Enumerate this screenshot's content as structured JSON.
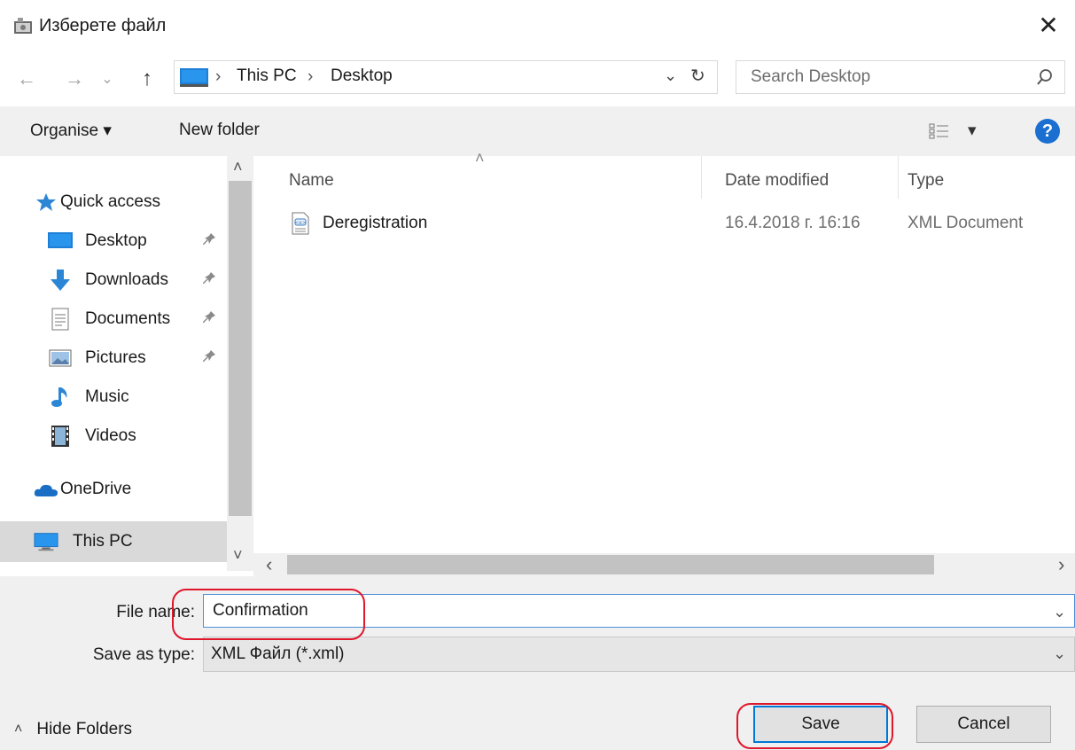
{
  "window": {
    "title": "Изберете файл",
    "close_glyph": "✕"
  },
  "address": {
    "back_glyph": "←",
    "forward_glyph": "→",
    "recent_glyph": "⌄",
    "up_glyph": "↑",
    "breadcrumb": [
      "This PC",
      "Desktop"
    ],
    "separator": "›",
    "dropdown_glyph": "⌄",
    "refresh_glyph": "↻"
  },
  "search": {
    "placeholder": "Search Desktop",
    "icon": "search-icon"
  },
  "toolbar": {
    "organise_label": "Organise ▾",
    "new_folder_label": "New folder",
    "view_glyph": "▾",
    "help_glyph": "?"
  },
  "nav": {
    "quick_access": "Quick access",
    "items": [
      {
        "label": "Desktop",
        "icon": "desktop-icon",
        "pinned": true
      },
      {
        "label": "Downloads",
        "icon": "downloads-icon",
        "pinned": true
      },
      {
        "label": "Documents",
        "icon": "documents-icon",
        "pinned": true
      },
      {
        "label": "Pictures",
        "icon": "pictures-icon",
        "pinned": true
      },
      {
        "label": "Music",
        "icon": "music-icon",
        "pinned": false
      },
      {
        "label": "Videos",
        "icon": "videos-icon",
        "pinned": false
      }
    ],
    "onedrive": "OneDrive",
    "thispc": "This PC",
    "pin_glyph": "📌",
    "scroll_up_glyph": "˄",
    "scroll_down_glyph": "˅"
  },
  "columns": {
    "name": "Name",
    "date": "Date modified",
    "type": "Type",
    "sort_glyph": "˄"
  },
  "files": [
    {
      "name": "Deregistration",
      "date": "16.4.2018 г. 16:16",
      "type": "XML Document",
      "icon": "xml-file-icon"
    }
  ],
  "hscroll": {
    "left_glyph": "‹",
    "right_glyph": "›"
  },
  "form": {
    "filename_label": "File name:",
    "filename_value": "Confirmation",
    "savetype_label": "Save as type:",
    "savetype_value": "XML Файл (*.xml)",
    "dropdown_glyph": "⌄"
  },
  "footer": {
    "hide_folders": "Hide Folders",
    "hide_glyph": "˄",
    "save_label": "Save",
    "cancel_label": "Cancel"
  },
  "colors": {
    "accent": "#0078d7",
    "annotation": "#e0162b",
    "panel_bg": "#f0f0f0",
    "help_blue": "#1b6fd1"
  }
}
